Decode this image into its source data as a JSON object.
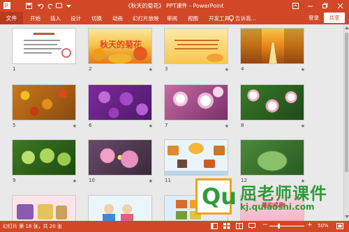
{
  "window": {
    "title": "《秋天的菊花》 PPT课件 - PowerPoint"
  },
  "ribbon": {
    "file": "文件",
    "tabs": [
      "开始",
      "插入",
      "设计",
      "切换",
      "动画",
      "幻灯片放映",
      "审阅",
      "视图",
      "开发工具"
    ],
    "tell_me": "告诉我...",
    "login": "登录",
    "share": "共享"
  },
  "slides": [
    {
      "n": "1",
      "star": ""
    },
    {
      "n": "2",
      "star": "★",
      "text": "秋天的菊花"
    },
    {
      "n": "3",
      "star": "★"
    },
    {
      "n": "4",
      "star": "★"
    },
    {
      "n": "5",
      "star": "★"
    },
    {
      "n": "6",
      "star": "★"
    },
    {
      "n": "7",
      "star": "★"
    },
    {
      "n": "8",
      "star": "★"
    },
    {
      "n": "9",
      "star": "★"
    },
    {
      "n": "10",
      "star": "★"
    },
    {
      "n": "11",
      "star": "★"
    },
    {
      "n": "12",
      "star": "★"
    },
    {
      "n": "",
      "star": ""
    },
    {
      "n": "",
      "star": ""
    },
    {
      "n": "",
      "star": "",
      "text": "菊的成果"
    },
    {
      "n": "",
      "star": ""
    }
  ],
  "status": {
    "slide_count": "幻灯片 第 18 张，共 20 张",
    "zoom": "50%"
  },
  "watermark": {
    "logo": "Qu",
    "cn": "屈老师课件",
    "url": "kj.qulaoshi.com"
  },
  "colors": {
    "accent": "#d24726",
    "watermark_green": "#2e9c3a",
    "watermark_orange": "#f0a21a"
  }
}
